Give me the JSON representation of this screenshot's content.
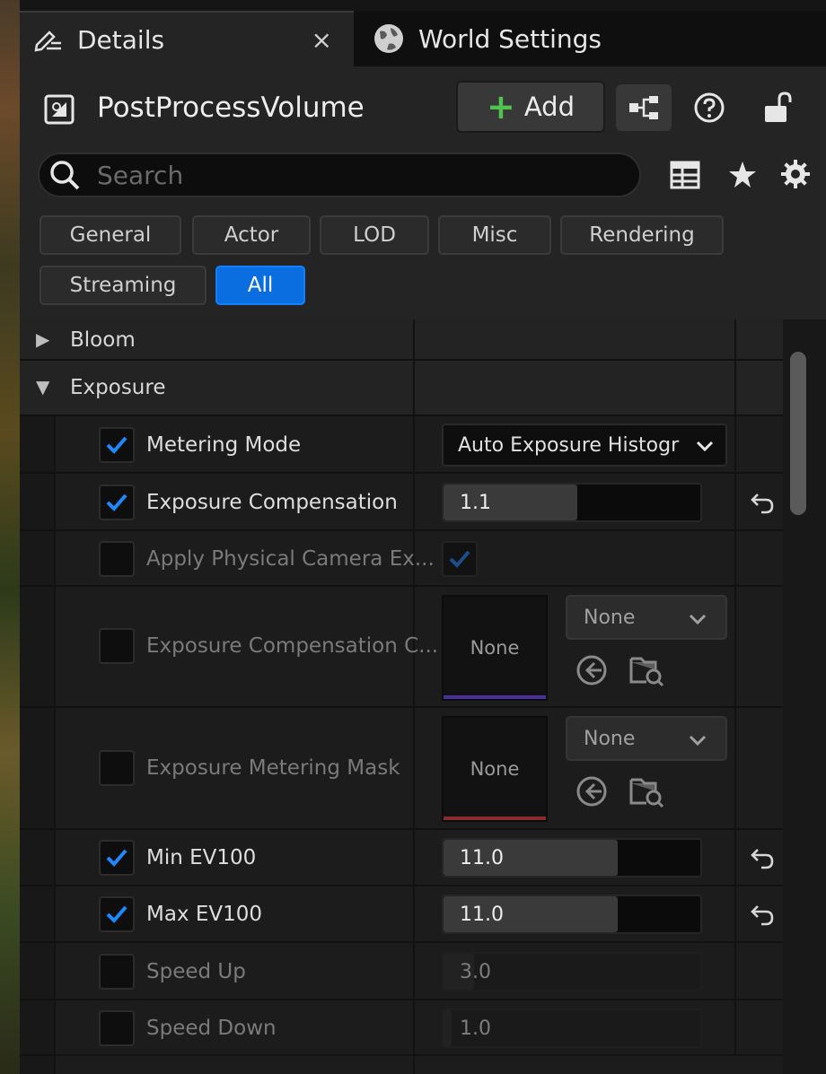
{
  "tabs": [
    {
      "label": "Details",
      "close": "×"
    },
    {
      "label": "World Settings"
    }
  ],
  "header": {
    "actor_name": "PostProcessVolume",
    "add_label": "Add",
    "add_plus": "+"
  },
  "search": {
    "placeholder": "Search"
  },
  "filters": [
    "General",
    "Actor",
    "LOD",
    "Misc",
    "Rendering",
    "Streaming",
    "All"
  ],
  "active_filter": "All",
  "categories": {
    "bloom": "Bloom",
    "exposure": "Exposure"
  },
  "properties": {
    "metering_mode": {
      "label": "Metering Mode",
      "value": "Auto Exposure Histogr",
      "checked": true
    },
    "exposure_comp": {
      "label": "Exposure Compensation",
      "value": "1.1",
      "checked": true
    },
    "apply_physical": {
      "label": "Apply Physical Camera Ex...",
      "checked": false
    },
    "exposure_comp_curve": {
      "label": "Exposure Compensation C...",
      "thumb": "None",
      "asset": "None",
      "checked": false
    },
    "metering_mask": {
      "label": "Exposure Metering Mask",
      "thumb": "None",
      "asset": "None",
      "checked": false
    },
    "min_ev100": {
      "label": "Min EV100",
      "value": "11.0",
      "checked": true
    },
    "max_ev100": {
      "label": "Max EV100",
      "value": "11.0",
      "checked": true
    },
    "speed_up": {
      "label": "Speed Up",
      "value": "3.0",
      "checked": false
    },
    "speed_down": {
      "label": "Speed Down",
      "value": "1.0",
      "checked": false
    }
  },
  "colors": {
    "accent": "#0a6ee0",
    "add_plus": "#4fc24f",
    "check": "#1e88ff",
    "curve_line": "#4a2f9a",
    "mask_line": "#8a2a2a"
  },
  "icons": {
    "details_tab": "pencil-lines-icon",
    "world_tab": "globe-icon",
    "actor": "post-process-volume-icon",
    "hierarchy": "blueprint-hierarchy-icon",
    "help": "help-icon",
    "lock": "unlock-icon",
    "search": "search-icon",
    "table": "table-view-icon",
    "favorite": "star-icon",
    "settings": "gear-icon"
  }
}
